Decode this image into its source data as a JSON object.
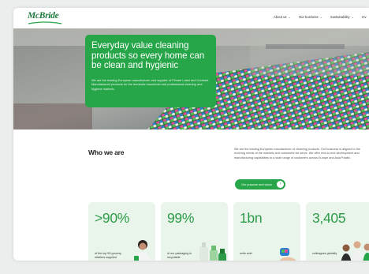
{
  "brand": {
    "name": "McBride",
    "color": "#1e7a3c",
    "accent": "#27a649"
  },
  "nav": {
    "items": [
      {
        "label": "About us"
      },
      {
        "label": "Our business"
      },
      {
        "label": "Sustainability"
      },
      {
        "label": "Inv"
      }
    ]
  },
  "hero": {
    "title": "Everyday value cleaning products so every home can be clean and hygienic",
    "description": "We are the leading European manufacturer and supplier of Private Label and Contract Manufactured products for the domestic household and professional cleaning and hygiene markets."
  },
  "who": {
    "title": "Who we are",
    "text": "We are the leading European manufacturer of cleaning products. Our business is aligned to the evolving needs of the markets and customers we serve. We offer end-to-end development and manufacturing capabilities to a wide range of customers across Europe and Asia Pacific.",
    "button_label": "Our purpose and vision",
    "button_icon": "arrow-right-icon"
  },
  "stats": [
    {
      "value": ">90%",
      "label": "of the top 50 grocery retailers supplied",
      "icon": "person-holding-product"
    },
    {
      "value": "99%",
      "label": "of our packaging is recyclable",
      "icon": "bottles"
    },
    {
      "value": "1bn",
      "label": "units sold",
      "icon": "hand-holding-capsule"
    },
    {
      "value": "3,405",
      "label": "colleagues globally",
      "icon": "colleagues-group"
    }
  ]
}
